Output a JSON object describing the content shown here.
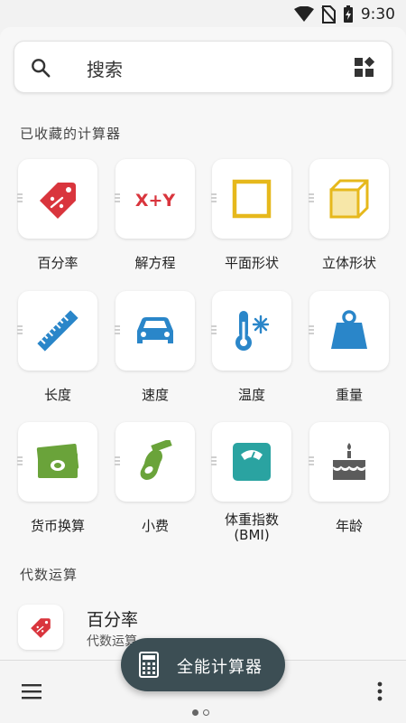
{
  "status_bar": {
    "time": "9:30",
    "icons": [
      "wifi-icon",
      "no-sim-icon",
      "battery-charging-icon"
    ]
  },
  "search": {
    "placeholder": "搜索",
    "icon": "search-icon",
    "action_icon": "widgets-icon"
  },
  "favorites": {
    "title": "已收藏的计算器",
    "items": [
      {
        "label": "百分率",
        "icon": "percent-tag-icon",
        "color": "#d9353d"
      },
      {
        "label": "解方程",
        "icon": "equation-xy-icon",
        "color": "#d9353d"
      },
      {
        "label": "平面形状",
        "icon": "square-icon",
        "color": "#e6b81c"
      },
      {
        "label": "立体形状",
        "icon": "cube-icon",
        "color": "#e6b81c"
      },
      {
        "label": "长度",
        "icon": "ruler-icon",
        "color": "#2a86c9"
      },
      {
        "label": "速度",
        "icon": "car-icon",
        "color": "#2a86c9"
      },
      {
        "label": "温度",
        "icon": "thermometer-icon",
        "color": "#2a86c9"
      },
      {
        "label": "重量",
        "icon": "weight-icon",
        "color": "#2a86c9"
      },
      {
        "label": "货币换算",
        "icon": "money-icon",
        "color": "#6aa33a"
      },
      {
        "label": "小费",
        "icon": "tip-hand-icon",
        "color": "#6aa33a"
      },
      {
        "label": "体重指数\n(BMI)",
        "icon": "scale-icon",
        "color": "#2aa3a1"
      },
      {
        "label": "年龄",
        "icon": "cake-icon",
        "color": "#5b5b5b"
      }
    ]
  },
  "algebra": {
    "title": "代数运算",
    "items": [
      {
        "title": "百分率",
        "subtitle": "代数运算",
        "icon": "percent-tag-icon",
        "color": "#d9353d"
      }
    ]
  },
  "fab": {
    "label": "全能计算器",
    "icon": "calculator-icon"
  },
  "bottom_bar": {
    "menu_icon": "menu-icon",
    "more_icon": "more-vert-icon",
    "pages": 2,
    "active_page": 0
  },
  "colors": {
    "fab_bg": "#3c4e54",
    "red": "#d9353d",
    "yellow": "#e6b81c",
    "blue": "#2a86c9",
    "green": "#6aa33a",
    "teal": "#2aa3a1"
  }
}
